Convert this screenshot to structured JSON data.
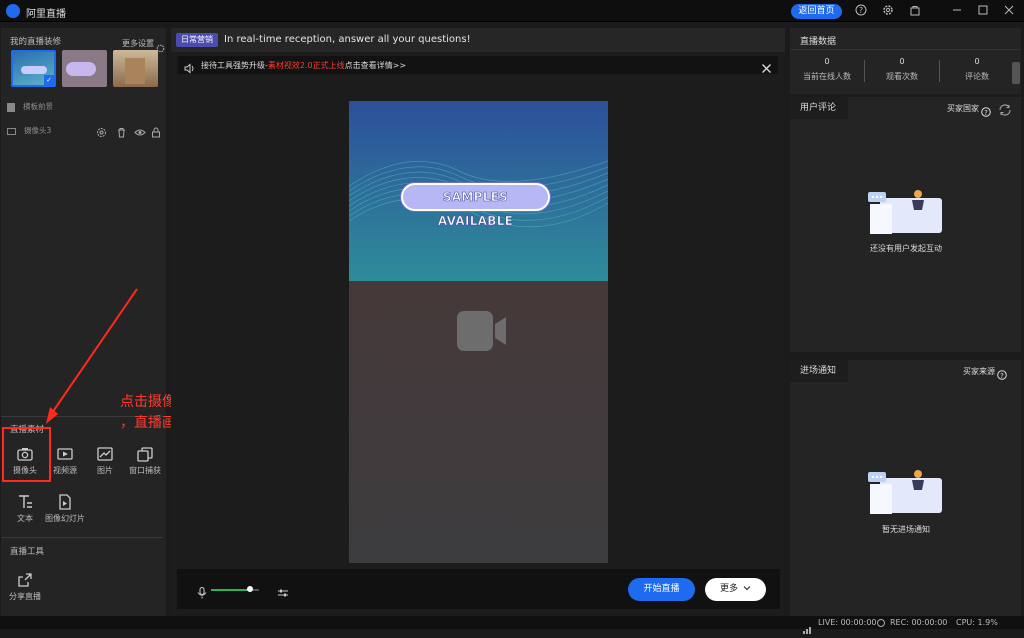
{
  "app": {
    "title": "阿里直播"
  },
  "titlebar": {
    "home_btn": "返回首页"
  },
  "left": {
    "decor_label": "我的直播装修",
    "more_settings": "更多设置",
    "layers": [
      "横板前景",
      "摄像头3"
    ],
    "material_label": "直播素材",
    "tools": [
      "摄像头",
      "视频源",
      "图片",
      "窗口捕获",
      "文本",
      "图像幻灯片"
    ],
    "live_tools_label": "直播工具",
    "share": "分享直播"
  },
  "center": {
    "tag": "日常营销",
    "notice": "In real-time reception, answer all your questions!",
    "promo_prefix": "接待工具强势升级-",
    "promo_highlight": "素材视效2.0正式上线",
    "promo_suffix": "点击查看详情>>",
    "preview_banner": "SAMPLES AVAILABLE",
    "start": "开始直播",
    "more": "更多"
  },
  "right": {
    "data_title": "直播数据",
    "stats": [
      {
        "value": "0",
        "label": "当前在线人数"
      },
      {
        "value": "0",
        "label": "观看次数"
      },
      {
        "value": "0",
        "label": "评论数"
      }
    ],
    "comments_title": "用户评论",
    "buyer_country": "买家国家",
    "no_interaction": "还没有用户发起互动",
    "entry_title": "进场通知",
    "buyer_source": "买家来源",
    "no_entry": "暂无进场通知"
  },
  "status": {
    "live": "LIVE: 00:00:00",
    "rec": "REC: 00:00:00",
    "cpu": "CPU: 1.9%"
  },
  "annotation": {
    "line1": "点击摄像头，识别“BocaLive”名称摄像头并添加",
    "line2": "，直播画面自动同步过来"
  },
  "colors": {
    "accent": "#1e6bf0",
    "annotation": "#ff3b2f",
    "tag": "#4b4bb0"
  }
}
